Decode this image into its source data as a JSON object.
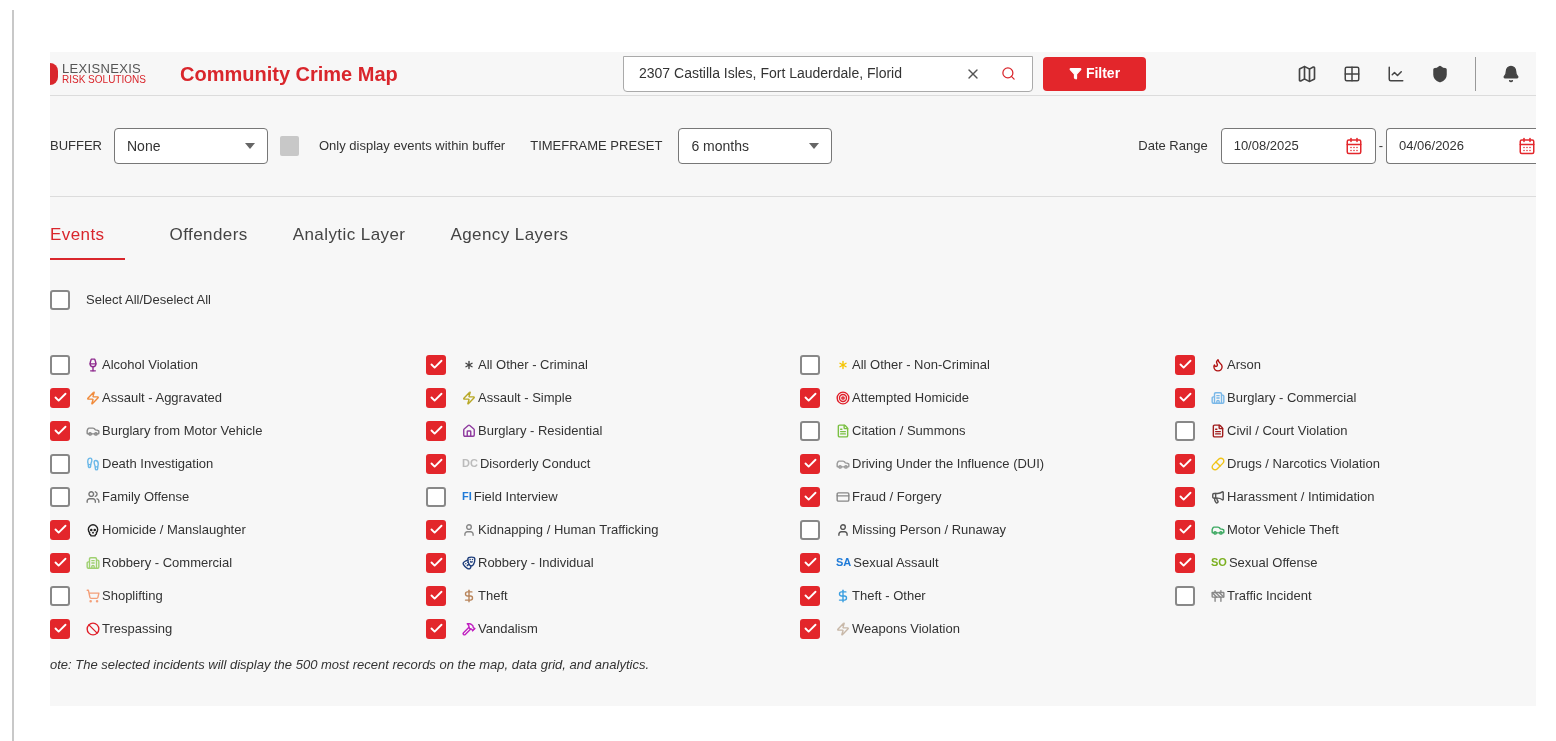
{
  "header": {
    "logo": {
      "name": "LEXISNEXIS",
      "tagline": "RISK SOLUTIONS"
    },
    "title": "Community Crime Map",
    "search": {
      "value": "2307 Castilla Isles, Fort Lauderdale, Florid"
    },
    "filter_button": "Filter"
  },
  "filters": {
    "buffer": {
      "label": "BUFFER",
      "value": "None"
    },
    "within_buffer": {
      "label": "Only display events within buffer",
      "checked": false
    },
    "timeframe": {
      "label": "TIMEFRAME PRESET",
      "value": "6 months"
    },
    "date_range": {
      "label": "Date Range",
      "start": "10/08/2025",
      "separator": "-",
      "end": "04/06/2026"
    }
  },
  "tabs": [
    {
      "label": "Events",
      "selected": true
    },
    {
      "label": "Offenders",
      "selected": false
    },
    {
      "label": "Analytic Layer",
      "selected": false
    },
    {
      "label": "Agency Layers",
      "selected": false
    }
  ],
  "select_all": {
    "label": "Select All/Deselect All",
    "checked": false
  },
  "events": [
    {
      "label": "Alcohol Violation",
      "checked": false
    },
    {
      "label": "All Other - Criminal",
      "checked": true
    },
    {
      "label": "All Other - Non-Criminal",
      "checked": false
    },
    {
      "label": "Arson",
      "checked": true
    },
    {
      "label": "Assault - Aggravated",
      "checked": true
    },
    {
      "label": "Assault - Simple",
      "checked": true
    },
    {
      "label": "Attempted Homicide",
      "checked": true
    },
    {
      "label": "Burglary - Commercial",
      "checked": true
    },
    {
      "label": "Burglary from Motor Vehicle",
      "checked": true
    },
    {
      "label": "Burglary - Residential",
      "checked": true
    },
    {
      "label": "Citation / Summons",
      "checked": false
    },
    {
      "label": "Civil / Court Violation",
      "checked": false
    },
    {
      "label": "Death Investigation",
      "checked": false
    },
    {
      "label": "Disorderly Conduct",
      "checked": true,
      "tag": "DC"
    },
    {
      "label": "Driving Under the Influence (DUI)",
      "checked": true
    },
    {
      "label": "Drugs / Narcotics Violation",
      "checked": true
    },
    {
      "label": "Family Offense",
      "checked": false
    },
    {
      "label": "Field Interview",
      "checked": false,
      "tag": "FI"
    },
    {
      "label": "Fraud / Forgery",
      "checked": true
    },
    {
      "label": "Harassment / Intimidation",
      "checked": true
    },
    {
      "label": "Homicide / Manslaughter",
      "checked": true
    },
    {
      "label": "Kidnapping / Human Trafficking",
      "checked": true
    },
    {
      "label": "Missing Person / Runaway",
      "checked": false
    },
    {
      "label": "Motor Vehicle Theft",
      "checked": true
    },
    {
      "label": "Robbery - Commercial",
      "checked": true
    },
    {
      "label": "Robbery - Individual",
      "checked": true
    },
    {
      "label": "Sexual Assault",
      "checked": true,
      "tag": "SA"
    },
    {
      "label": "Sexual Offense",
      "checked": true,
      "tag": "SO"
    },
    {
      "label": "Shoplifting",
      "checked": false
    },
    {
      "label": "Theft",
      "checked": true
    },
    {
      "label": "Theft - Other",
      "checked": true
    },
    {
      "label": "Traffic Incident",
      "checked": false
    },
    {
      "label": "Trespassing",
      "checked": true
    },
    {
      "label": "Vandalism",
      "checked": true
    },
    {
      "label": "Weapons Violation",
      "checked": true
    }
  ],
  "note": "ote: The selected incidents will display the 500 most recent records on the map, data grid, and analytics."
}
